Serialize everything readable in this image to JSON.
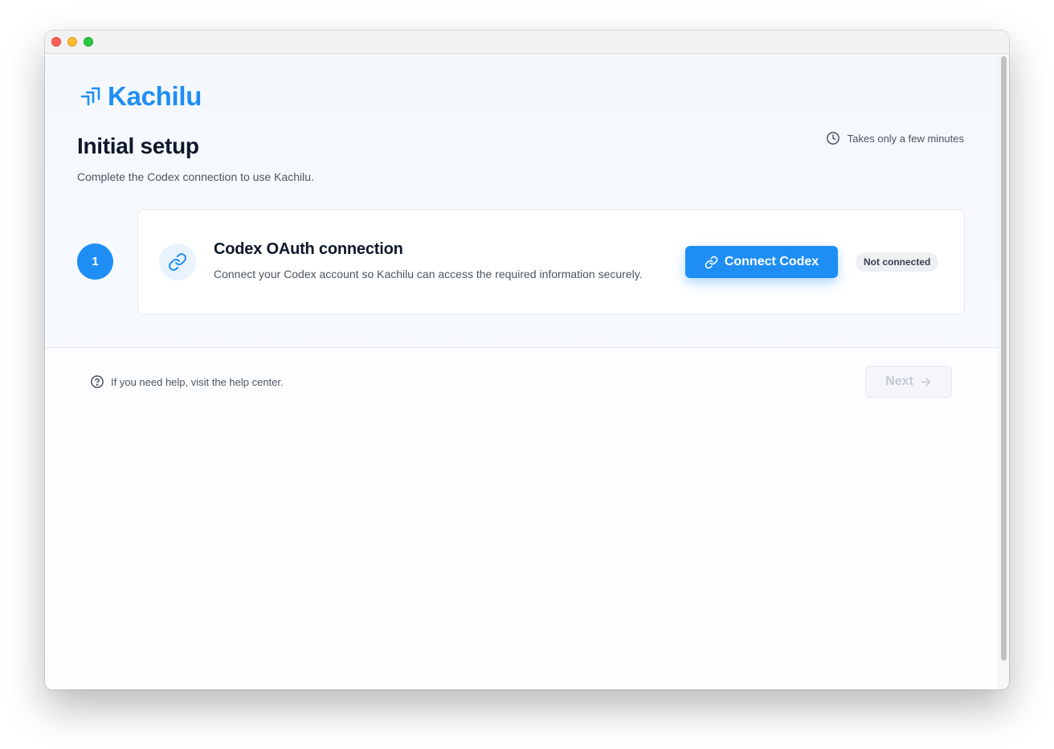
{
  "app": {
    "brand": "Kachilu"
  },
  "header": {
    "title": "Initial setup",
    "subtitle": "Complete the Codex connection to use Kachilu.",
    "eta": "Takes only a few minutes"
  },
  "step": {
    "number": "1",
    "title": "Codex OAuth connection",
    "description": "Connect your Codex account so Kachilu can access the required information securely.",
    "connect_label": "Connect Codex",
    "status": "Not connected"
  },
  "footer": {
    "help_text": "If you need help, visit the help center.",
    "next_label": "Next"
  },
  "colors": {
    "accent": "#1e8ef4",
    "text_primary": "#0f172a",
    "text_secondary": "#4b5563"
  },
  "icons": {
    "logo": "kachilu-logo-mark",
    "eta": "clock-icon",
    "step": "link-icon",
    "help": "help-circle-icon",
    "next": "arrow-right-icon"
  }
}
